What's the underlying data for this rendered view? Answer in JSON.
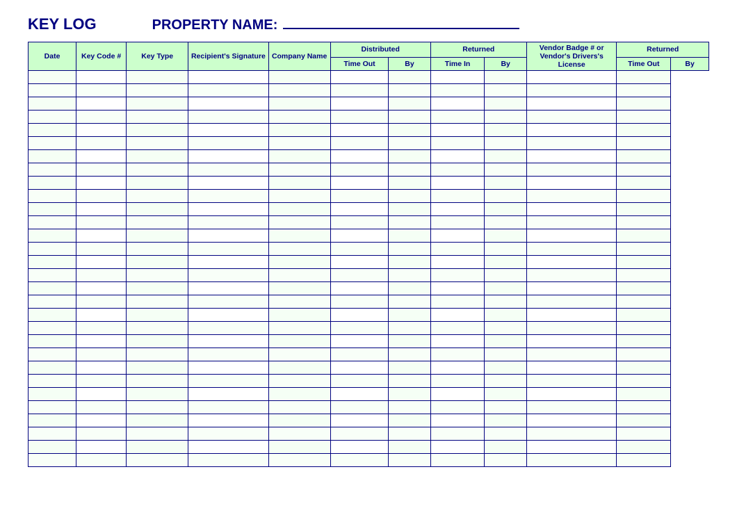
{
  "header": {
    "title": "KEY LOG",
    "property_label": "PROPERTY NAME:",
    "property_value": ""
  },
  "table": {
    "columns": {
      "date": "Date",
      "key_code": "Key Code #",
      "key_type": "Key Type",
      "recipient_signature": "Recipient's Signature",
      "company_name": "Company Name",
      "distributed": "Distributed",
      "dist_time_out": "Time Out",
      "dist_by": "By",
      "returned": "Returned",
      "ret_time_in": "Time In",
      "ret_by": "By",
      "vendor_badge": "Vendor Badge # or Vendor's Drivers's License",
      "returned2": "Returned",
      "ret2_time_out": "Time Out",
      "ret2_by": "By"
    },
    "row_count": 30
  }
}
